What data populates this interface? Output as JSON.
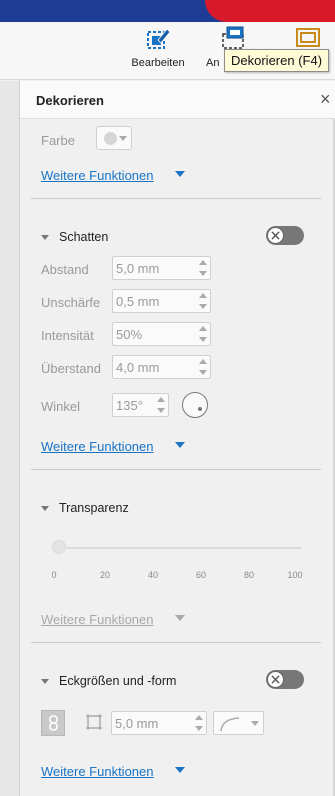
{
  "toolbar": {
    "edit_label": "Bearbeiten",
    "arrange_label": "An",
    "tooltip": "Dekorieren (F4)"
  },
  "panel": {
    "title": "Dekorieren",
    "close_symbol": "×",
    "color_label": "Farbe",
    "more_functions": "Weitere Funktionen",
    "shadow": {
      "title": "Schatten",
      "distance_label": "Abstand",
      "distance_value": "5,0 mm",
      "blur_label": "Unschärfe",
      "blur_value": "0,5 mm",
      "intensity_label": "Intensität",
      "intensity_value": "50%",
      "overhang_label": "Überstand",
      "overhang_value": "4,0 mm",
      "angle_label": "Winkel",
      "angle_value": "135°"
    },
    "transparency": {
      "title": "Transparenz",
      "ticks": [
        "0",
        "20",
        "40",
        "60",
        "80",
        "100"
      ],
      "value": 0
    },
    "corners": {
      "title": "Eckgrößen und -form",
      "size_value": "5,0 mm"
    }
  },
  "colors": {
    "accent_blue": "#1a74c6",
    "header_blue": "#1f3c94",
    "brand_red": "#d7192a",
    "tooltip_bg": "#fffbd7"
  }
}
